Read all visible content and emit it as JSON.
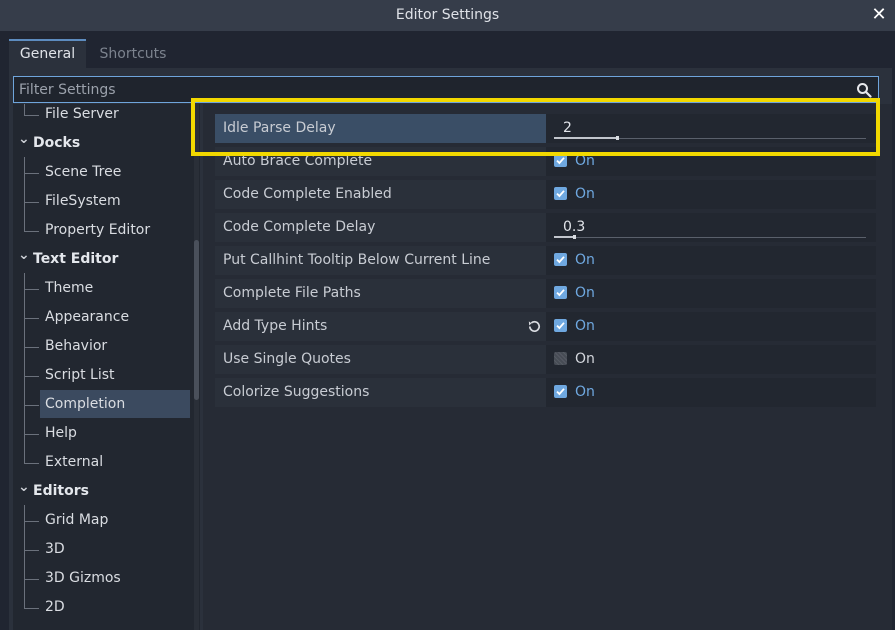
{
  "window": {
    "title": "Editor Settings",
    "close_label": "✕"
  },
  "tabs": [
    {
      "label": "General",
      "active": true
    },
    {
      "label": "Shortcuts",
      "active": false
    }
  ],
  "filter": {
    "placeholder": "Filter Settings",
    "value": ""
  },
  "sidebar": {
    "items": [
      {
        "label": "File Server",
        "kind": "child"
      },
      {
        "label": "Docks",
        "kind": "category"
      },
      {
        "label": "Scene Tree",
        "kind": "child"
      },
      {
        "label": "FileSystem",
        "kind": "child"
      },
      {
        "label": "Property Editor",
        "kind": "child"
      },
      {
        "label": "Text Editor",
        "kind": "category"
      },
      {
        "label": "Theme",
        "kind": "child"
      },
      {
        "label": "Appearance",
        "kind": "child"
      },
      {
        "label": "Behavior",
        "kind": "child"
      },
      {
        "label": "Script List",
        "kind": "child"
      },
      {
        "label": "Completion",
        "kind": "child",
        "selected": true
      },
      {
        "label": "Help",
        "kind": "child"
      },
      {
        "label": "External",
        "kind": "child"
      },
      {
        "label": "Editors",
        "kind": "category"
      },
      {
        "label": "Grid Map",
        "kind": "child"
      },
      {
        "label": "3D",
        "kind": "child"
      },
      {
        "label": "3D Gizmos",
        "kind": "child"
      },
      {
        "label": "2D",
        "kind": "child"
      }
    ]
  },
  "properties": [
    {
      "label": "Idle Parse Delay",
      "type": "range",
      "value": "2",
      "fraction": 0.2,
      "selected": true
    },
    {
      "label": "Auto Brace Complete",
      "type": "bool",
      "checked": true,
      "value_label": "On"
    },
    {
      "label": "Code Complete Enabled",
      "type": "bool",
      "checked": true,
      "value_label": "On"
    },
    {
      "label": "Code Complete Delay",
      "type": "range",
      "value": "0.3",
      "fraction": 0.06
    },
    {
      "label": "Put Callhint Tooltip Below Current Line",
      "type": "bool",
      "checked": true,
      "value_label": "On"
    },
    {
      "label": "Complete File Paths",
      "type": "bool",
      "checked": true,
      "value_label": "On"
    },
    {
      "label": "Add Type Hints",
      "type": "bool",
      "checked": true,
      "value_label": "On",
      "revert": true
    },
    {
      "label": "Use Single Quotes",
      "type": "bool",
      "checked": false,
      "value_label": "On"
    },
    {
      "label": "Colorize Suggestions",
      "type": "bool",
      "checked": true,
      "value_label": "On"
    }
  ],
  "colors": {
    "accent": "#6fa8e0",
    "highlight_box": "#f2d800",
    "selection": "#3a4e66"
  },
  "icons": {
    "search": "search-icon",
    "revert": "revert-icon",
    "close": "close-icon"
  }
}
